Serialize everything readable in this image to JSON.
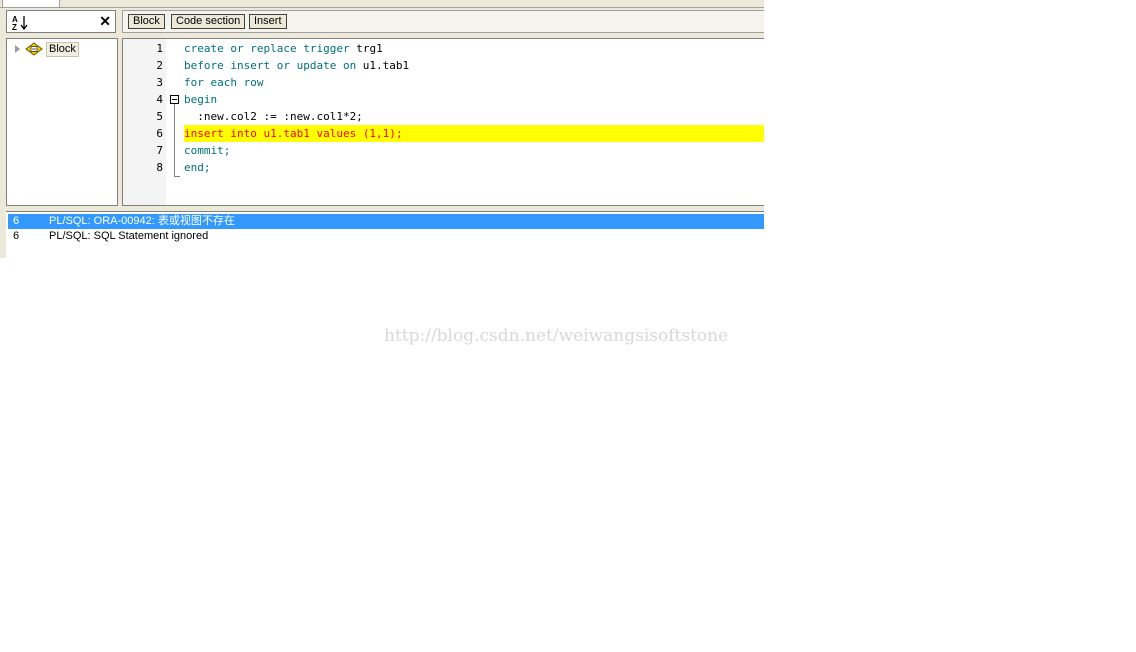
{
  "tree_panel": {
    "sort_icon": "sort-az-icon",
    "close_icon_glyph": "✕",
    "node": {
      "label": "Block",
      "icon": "block-icon"
    }
  },
  "editor_toolbar": {
    "buttons": [
      "Block",
      "Code section",
      "Insert"
    ]
  },
  "editor": {
    "line_numbers": [
      "1",
      "2",
      "3",
      "4",
      "5",
      "6",
      "7",
      "8"
    ],
    "lines": [
      "create or replace trigger trg1",
      "before insert or update on u1.tab1",
      "for each row",
      "begin",
      "  :new.col2 := :new.col1*2;",
      "insert into u1.tab1 values (1,1);",
      "commit;",
      "end;"
    ],
    "highlighted_line": 6,
    "highlight_color": "#ffff00",
    "keyword_color": "#00707a"
  },
  "errors": [
    {
      "line": "6",
      "message": "PL/SQL: ORA-00942: 表或视图不存在",
      "selected": true
    },
    {
      "line": "6",
      "message": "PL/SQL: SQL Statement ignored",
      "selected": false
    }
  ],
  "watermark": "http://blog.csdn.net/weiwangsisoftstone"
}
